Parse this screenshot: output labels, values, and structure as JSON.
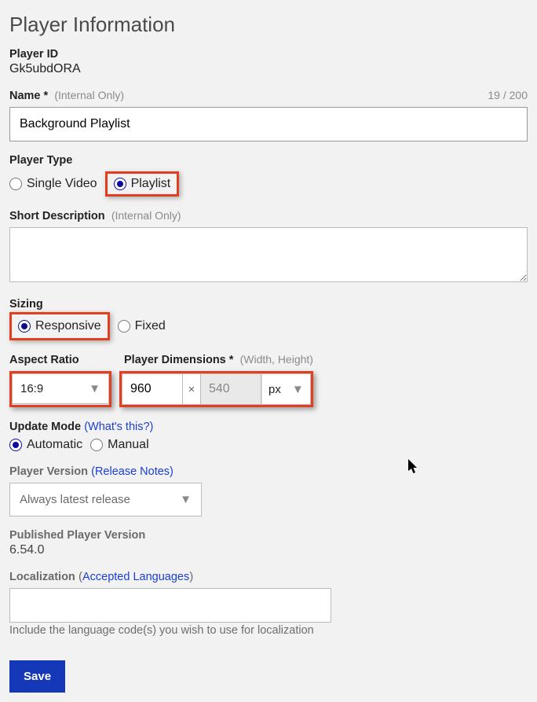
{
  "page": {
    "title": "Player Information"
  },
  "playerId": {
    "label": "Player ID",
    "value": "Gk5ubdORA"
  },
  "name": {
    "label": "Name *",
    "hint": "(Internal Only)",
    "value": "Background Playlist",
    "counter": "19 / 200"
  },
  "playerType": {
    "label": "Player Type",
    "options": {
      "single": "Single Video",
      "playlist": "Playlist"
    }
  },
  "shortDesc": {
    "label": "Short Description",
    "hint": "(Internal Only)",
    "value": ""
  },
  "sizing": {
    "label": "Sizing",
    "options": {
      "responsive": "Responsive",
      "fixed": "Fixed"
    }
  },
  "aspect": {
    "label": "Aspect Ratio",
    "selected": "16:9"
  },
  "dimensions": {
    "label": "Player Dimensions *",
    "hint": "(Width, Height)",
    "width": "960",
    "height": "540",
    "x": "×",
    "unit": "px"
  },
  "updateMode": {
    "label": "Update Mode",
    "link": "(What's this?)",
    "options": {
      "automatic": "Automatic",
      "manual": "Manual"
    }
  },
  "playerVersion": {
    "label": "Player Version",
    "link": "(Release Notes)",
    "selected": "Always latest release"
  },
  "published": {
    "label": "Published Player Version",
    "value": "6.54.0"
  },
  "localization": {
    "label": "Localization",
    "link": "(Accepted Languages)",
    "value": "",
    "helper": "Include the language code(s) you wish to use for localization"
  },
  "buttons": {
    "save": "Save"
  }
}
